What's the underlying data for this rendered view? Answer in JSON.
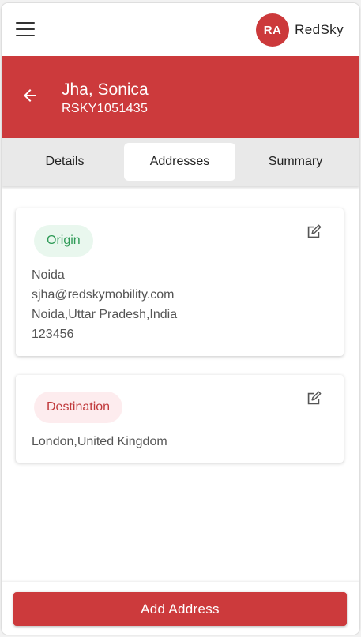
{
  "app": {
    "brand_initials": "RA",
    "brand_name": "RedSky",
    "accent_color": "#cc3a3c"
  },
  "header": {
    "name": "Jha, Sonica",
    "id": "RSKY1051435"
  },
  "tabs": [
    {
      "label": "Details",
      "active": false
    },
    {
      "label": "Addresses",
      "active": true
    },
    {
      "label": "Summary",
      "active": false
    }
  ],
  "addresses": [
    {
      "type": "Origin",
      "lines": [
        "Noida",
        "sjha@redskymobility.com",
        "Noida,Uttar Pradesh,India",
        "123456"
      ]
    },
    {
      "type": "Destination",
      "lines": [
        "London,United Kingdom"
      ]
    }
  ],
  "footer": {
    "add_button_label": "Add Address"
  },
  "icons": [
    "menu-icon",
    "back-arrow-icon",
    "edit-icon"
  ]
}
